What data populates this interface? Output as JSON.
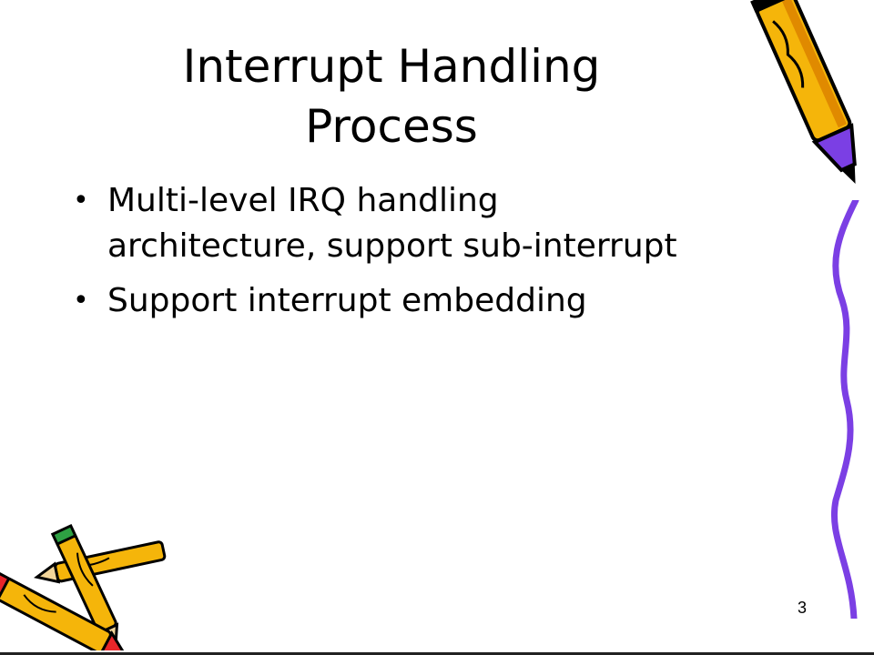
{
  "slide": {
    "title_line1": "Interrupt Handling",
    "title_line2": "Process",
    "bullets": [
      {
        "marker": "•",
        "lines": [
          "Multi-level IRQ handling",
          "architecture, support sub-interrupt"
        ]
      },
      {
        "marker": "•",
        "lines": [
          "Support interrupt embedding"
        ]
      }
    ],
    "page_number": "3"
  },
  "decorations": {
    "pencil_top_right": "pencil-icon",
    "pencils_bottom_left": "pencils-icon",
    "squiggle_right": "squiggle-line",
    "colors": {
      "pencil_body": "#f5b50a",
      "pencil_purple": "#7b3fe4",
      "pencil_red": "#e8262a",
      "pencil_green": "#2ea043"
    }
  }
}
